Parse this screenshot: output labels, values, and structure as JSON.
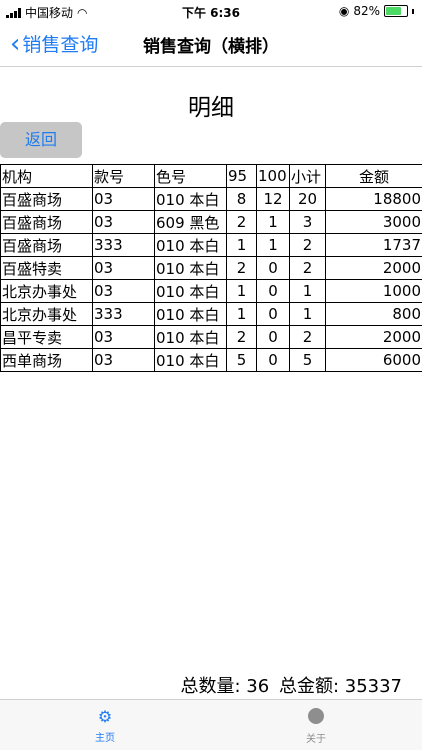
{
  "status_bar": {
    "carrier": "中国移动",
    "time": "下午 6:36",
    "battery": "82%",
    "battery_level": 0.82
  },
  "nav": {
    "back_label": "销售查询",
    "title": "销售查询（横排）"
  },
  "page": {
    "heading": "明细",
    "return_button": "返回"
  },
  "table": {
    "headers": [
      "机构",
      "款号",
      "色号",
      "95",
      "100",
      "小计",
      "金额"
    ],
    "rows": [
      [
        "百盛商场",
        "03",
        "010 本白",
        "8",
        "12",
        "20",
        "18800"
      ],
      [
        "百盛商场",
        "03",
        "609 黑色",
        "2",
        "1",
        "3",
        "3000"
      ],
      [
        "百盛商场",
        "333",
        "010 本白",
        "1",
        "1",
        "2",
        "1737"
      ],
      [
        "百盛特卖",
        "03",
        "010 本白",
        "2",
        "0",
        "2",
        "2000"
      ],
      [
        "北京办事处",
        "03",
        "010 本白",
        "1",
        "0",
        "1",
        "1000"
      ],
      [
        "北京办事处",
        "333",
        "010 本白",
        "1",
        "0",
        "1",
        "800"
      ],
      [
        "昌平专卖",
        "03",
        "010 本白",
        "2",
        "0",
        "2",
        "2000"
      ],
      [
        "西单商场",
        "03",
        "010 本白",
        "5",
        "0",
        "5",
        "6000"
      ]
    ]
  },
  "summary": {
    "total_qty": "总数量: 36",
    "total_amount": "总金额: 35337"
  },
  "tabbar": {
    "home": "主页",
    "about": "关于",
    "home_icon": "gear-icon",
    "about_icon": "circle-icon"
  }
}
